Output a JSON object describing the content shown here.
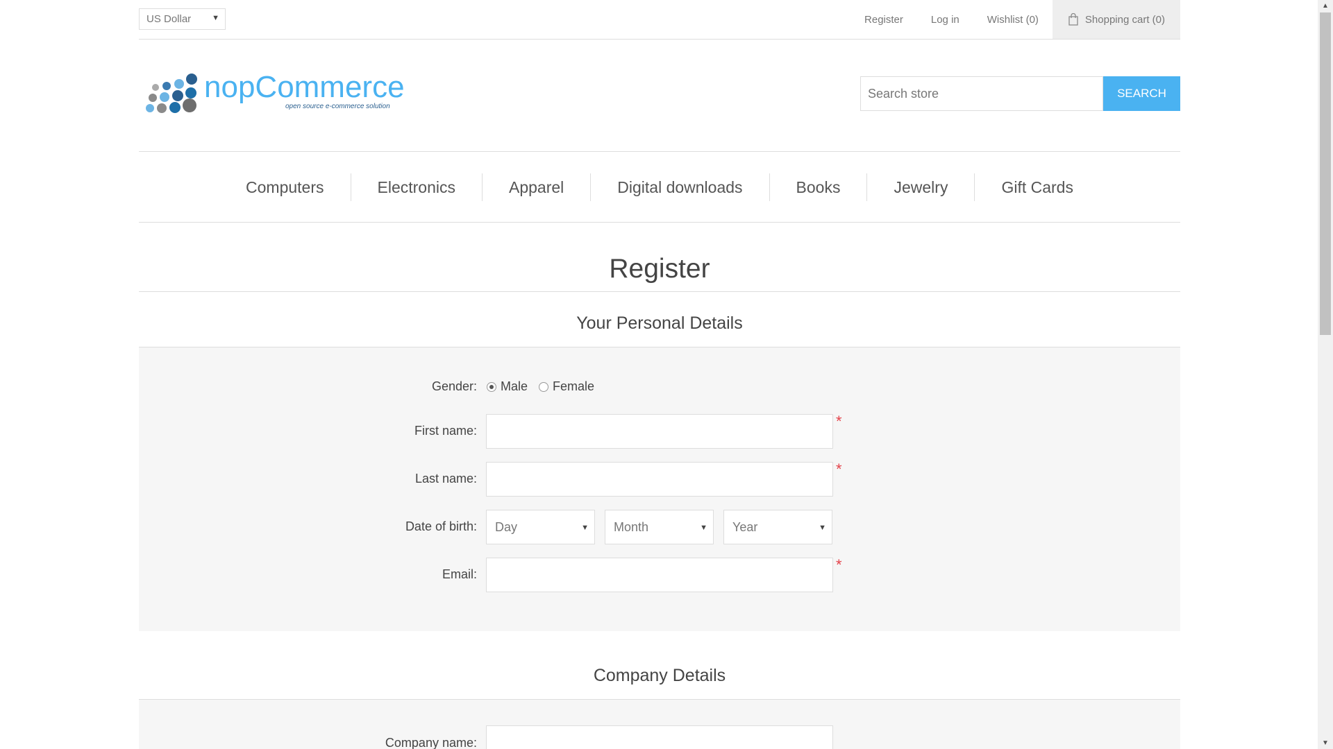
{
  "header": {
    "currency": "US Dollar",
    "links": {
      "register": "Register",
      "login": "Log in",
      "wishlist": "Wishlist (0)",
      "cart": "Shopping cart (0)"
    },
    "logo_text": "nopCommerce",
    "logo_tagline": "open source e-commerce solution",
    "search": {
      "placeholder": "Search store",
      "button": "Search"
    }
  },
  "nav": {
    "items": [
      "Computers",
      "Electronics",
      "Apparel",
      "Digital downloads",
      "Books",
      "Jewelry",
      "Gift Cards"
    ]
  },
  "page": {
    "title": "Register"
  },
  "personal": {
    "title": "Your Personal Details",
    "gender_label": "Gender:",
    "gender_male": "Male",
    "gender_female": "Female",
    "gender_selected": "Male",
    "first_name_label": "First name:",
    "last_name_label": "Last name:",
    "dob_label": "Date of birth:",
    "dob_day": "Day",
    "dob_month": "Month",
    "dob_year": "Year",
    "email_label": "Email:",
    "required_mark": "*"
  },
  "company": {
    "title": "Company Details",
    "company_name_label": "Company name:"
  },
  "colors": {
    "accent": "#4ab2f1",
    "required": "#e4434b",
    "panel": "#f6f6f6"
  }
}
